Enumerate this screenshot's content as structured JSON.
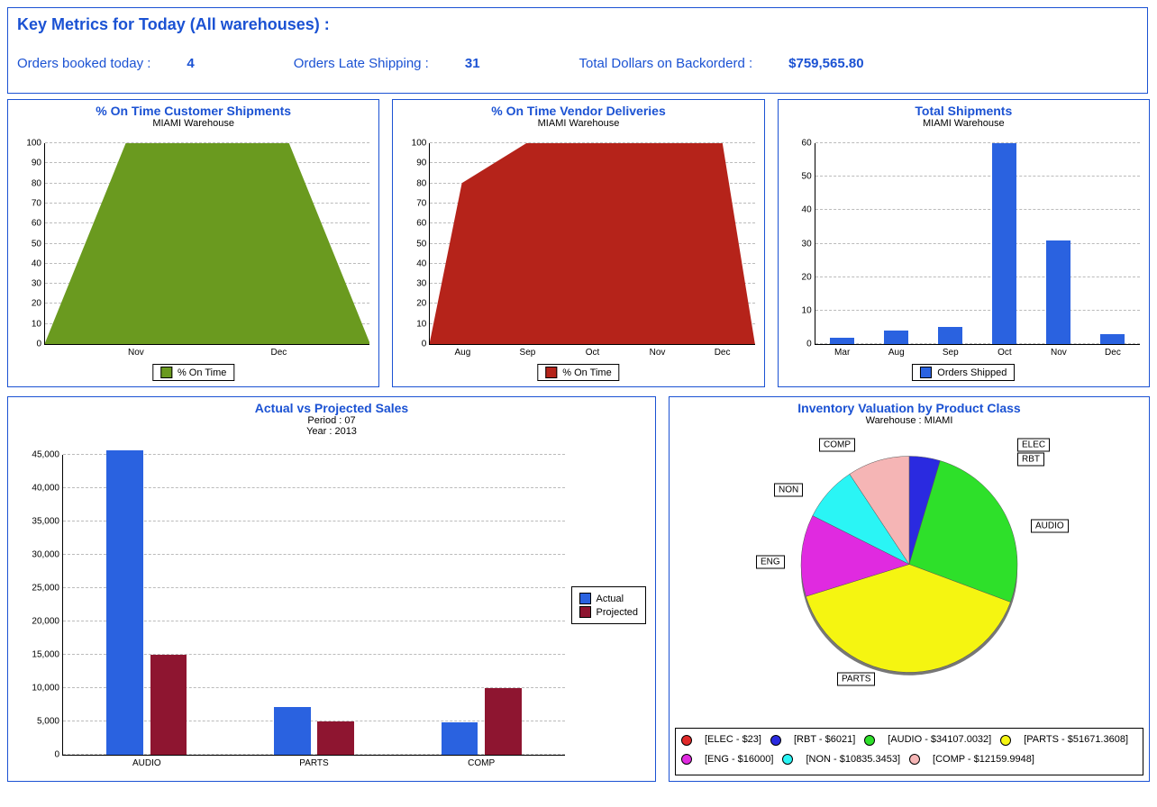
{
  "header": {
    "title": "Key Metrics for Today (All warehouses) :",
    "orders_booked_label": "Orders booked today :",
    "orders_booked_value": "4",
    "orders_late_label": "Orders Late Shipping :",
    "orders_late_value": "31",
    "backorder_label": "Total Dollars on Backorderd :",
    "backorder_value": "$759,565.80"
  },
  "chart_data": [
    {
      "id": "ontime_cust",
      "type": "area",
      "title": "% On Time Customer Shipments",
      "subtitle": "MIAMI Warehouse",
      "color": "#6a9a1f",
      "legend": "% On Time",
      "ylim": [
        0,
        100
      ],
      "ystep": 10,
      "categories": [
        "Nov",
        "Dec"
      ],
      "values": [
        100,
        100
      ],
      "render_x": [
        0,
        0.25,
        0.75,
        1
      ],
      "render_y": [
        0,
        100,
        100,
        0
      ]
    },
    {
      "id": "ontime_vend",
      "type": "area",
      "title": "% On Time Vendor Deliveries",
      "subtitle": "MIAMI Warehouse",
      "color": "#b5231a",
      "legend": "% On Time",
      "ylim": [
        0,
        100
      ],
      "ystep": 10,
      "categories": [
        "Aug",
        "Sep",
        "Oct",
        "Nov",
        "Dec"
      ],
      "values": [
        80,
        100,
        100,
        100,
        100
      ],
      "render_x": [
        0,
        0.1,
        0.3,
        0.5,
        0.7,
        0.9,
        1
      ],
      "render_y": [
        0,
        80,
        100,
        100,
        100,
        100,
        0
      ]
    },
    {
      "id": "shipments",
      "type": "bar",
      "title": "Total Shipments",
      "subtitle": "MIAMI Warehouse",
      "color": "#2a62e0",
      "legend": "Orders Shipped",
      "ylim": [
        0,
        60
      ],
      "ystep": 10,
      "categories": [
        "Mar",
        "Aug",
        "Sep",
        "Oct",
        "Nov",
        "Dec"
      ],
      "values": [
        2,
        4,
        5,
        61,
        31,
        3
      ]
    },
    {
      "id": "sales",
      "type": "bar",
      "title": "Actual vs Projected Sales",
      "subtitle1": "Period : 07",
      "subtitle2": "Year : 2013",
      "ylim": [
        0,
        45000
      ],
      "ystep": 5000,
      "categories": [
        "AUDIO",
        "PARTS",
        "COMP"
      ],
      "series": [
        {
          "name": "Actual",
          "color": "#2a62e0",
          "values": [
            45700,
            7100,
            4800
          ]
        },
        {
          "name": "Projected",
          "color": "#8e1530",
          "values": [
            15000,
            5000,
            10000
          ]
        }
      ]
    },
    {
      "id": "inventory",
      "type": "pie",
      "title": "Inventory Valuation by Product Class",
      "subtitle": "Warehouse : MIAMI",
      "slices": [
        {
          "name": "ELEC",
          "value": 23,
          "color": "#e02a2a",
          "legend": "[ELEC   - $23]"
        },
        {
          "name": "RBT",
          "value": 6021,
          "color": "#2a2ae0",
          "legend": "[RBT    - $6021]"
        },
        {
          "name": "AUDIO",
          "value": 34107.0032,
          "color": "#2ee02a",
          "legend": "[AUDIO  - $34107.0032]"
        },
        {
          "name": "PARTS",
          "value": 51671.3608,
          "color": "#f5f511",
          "legend": "[PARTS  - $51671.3608]"
        },
        {
          "name": "ENG",
          "value": 16000,
          "color": "#e02ae0",
          "legend": "[ENG    - $16000]"
        },
        {
          "name": "NON",
          "value": 10835.3453,
          "color": "#2af5f5",
          "legend": "[NON    - $10835.3453]"
        },
        {
          "name": "COMP",
          "value": 12159.9948,
          "color": "#f5b5b5",
          "legend": "[COMP   - $12159.9948]"
        }
      ]
    }
  ]
}
